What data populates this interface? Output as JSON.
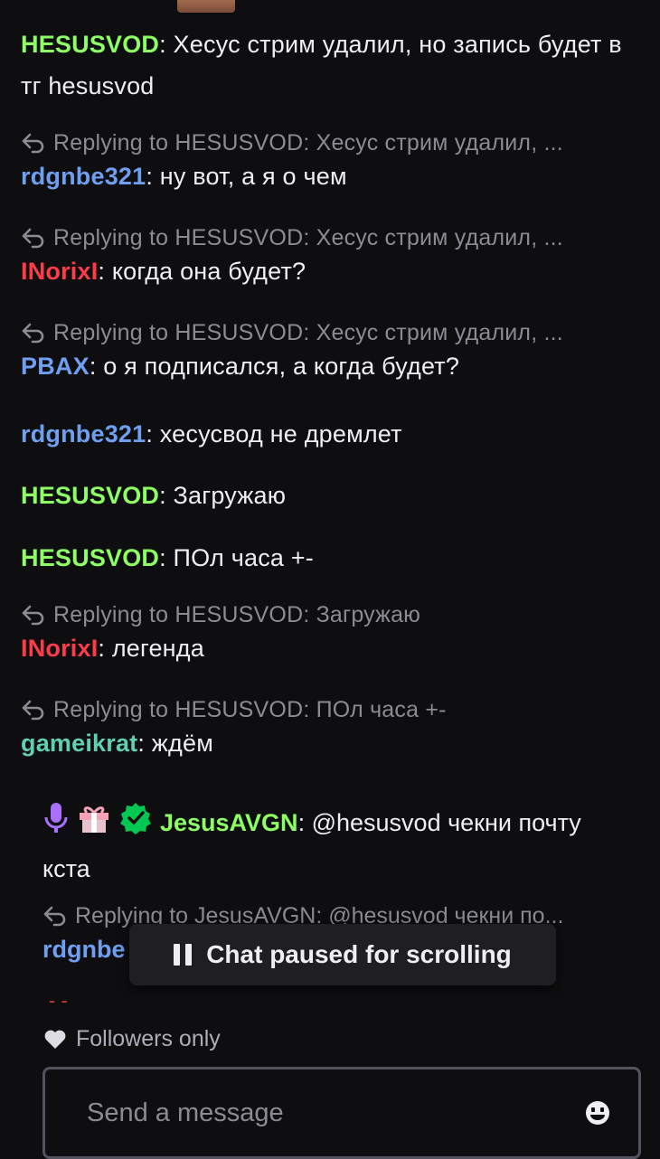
{
  "messages": [
    {
      "user": "HESUSVOD",
      "text": "Хесус стрим удалил, но запись будет в тг hesusvod",
      "color": "#8dff64"
    },
    {
      "reply": "Replying to HESUSVOD: Хесус стрим удалил, ...",
      "user": "rdgnbe321",
      "text": "ну вот, а я о чем",
      "color": "#6e9ff0"
    },
    {
      "reply": "Replying to HESUSVOD: Хесус стрим удалил, ...",
      "user": "INorixI",
      "text": "когда она будет?",
      "color": "#ff3b4a"
    },
    {
      "reply": "Replying to HESUSVOD: Хесус стрим удалил, ...",
      "user": "PBAX",
      "text": "о я подписался, а когда будет?",
      "color": "#6e9ff0"
    },
    {
      "user": "rdgnbe321",
      "text": "хесусвод не дремлет",
      "color": "#6e9ff0"
    },
    {
      "user": "HESUSVOD",
      "text": "Загружаю",
      "color": "#8dff64"
    },
    {
      "user": "HESUSVOD",
      "text": "ПОл часа +-",
      "color": "#8dff64"
    },
    {
      "reply": "Replying to HESUSVOD: Загружаю",
      "user": "INorixI",
      "text": "легенда",
      "color": "#ff3b4a"
    },
    {
      "reply": "Replying to HESUSVOD: ПОл часа +-",
      "user": "gameikrat",
      "text": "ждём",
      "color": "#5fd0b0"
    }
  ],
  "highlight": {
    "user": "JesusAVGN",
    "text": "@hesusvod чекни почту кста",
    "badges": [
      "microphone-badge",
      "gift-badge",
      "verified-badge"
    ]
  },
  "last_message": {
    "reply": "Replying to JesusAVGN: @hesusvod чекни по...",
    "user_visible": "rdgnbe"
  },
  "paused_banner": "Chat paused for scrolling",
  "followers_only": "Followers only",
  "input": {
    "placeholder": "Send a message"
  },
  "colon": ":"
}
